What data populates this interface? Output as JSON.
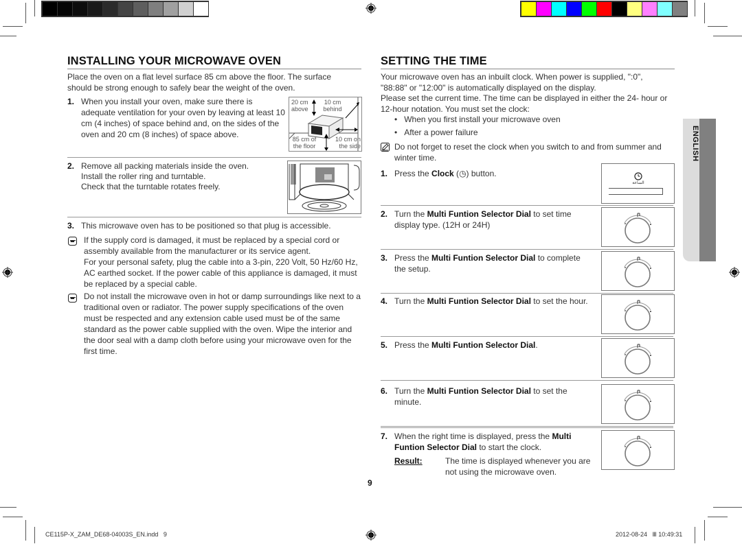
{
  "printer_marks": {
    "gray_swatches": [
      "#000000",
      "#050505",
      "#0d0d0d",
      "#1a1a1a",
      "#2b2b2b",
      "#444444",
      "#5e5e5e",
      "#7f7f7f",
      "#a0a0a0",
      "#d0d0d0",
      "#ffffff"
    ],
    "color_swatches": [
      "#ffff00",
      "#ff00ff",
      "#00ffff",
      "#0000ff",
      "#00ff00",
      "#ff0000",
      "#000000",
      "#ffff80",
      "#ff80ff",
      "#80ffff",
      "#808080"
    ]
  },
  "left": {
    "heading": "INSTALLING YOUR MICROWAVE OVEN",
    "intro": "Place the oven on a flat level surface 85 cm above the floor. The surface should be strong enough to safely bear the weight of the oven.",
    "step1": {
      "num": "1.",
      "text": "When you install your oven, make sure there is adequate ventilation for your oven by leaving at least 10 cm (4 inches) of space behind and, on the sides of the oven and 20 cm (8 inches) of space above.",
      "figure_labels": {
        "above": "20 cm above",
        "behind": "10 cm behind",
        "floor": "85 cm of the floor",
        "side": "10 cm on the side"
      }
    },
    "step2": {
      "num": "2.",
      "lines": [
        "Remove all packing materials inside the oven.",
        "Install the roller ring and turntable.",
        "Check that the turntable rotates freely."
      ]
    },
    "step3": {
      "num": "3.",
      "text": "This microwave oven has to be positioned so that plug is accessible."
    },
    "note1": {
      "line1": "If the supply cord is damaged, it must be replaced by a special cord or assembly available from the manufacturer or its service agent.",
      "line2": "For your personal safety, plug the cable into a 3-pin, 220 Volt, 50 Hz/60 Hz, AC earthed socket. If the power cable of this appliance is damaged, it must be replaced by a special cable."
    },
    "note2": {
      "text": "Do not install the microwave oven in hot or damp surroundings like next to a traditional oven or radiator. The power supply specifications of the oven must be respected and any extension cable used must be of the same standard as the power cable supplied with the oven. Wipe the interior and the door seal with a damp cloth before using your microwave oven for the first time."
    }
  },
  "right": {
    "heading": "SETTING THE TIME",
    "intro1": "Your microwave oven has an inbuilt clock. When power is supplied, \":0\", \"88:88\" or \"12:00\" is automatically displayed on the display.",
    "intro2": "Please set the current time. The time can be displayed in either the 24- hour or 12-hour notation. You must set the clock:",
    "bullets": [
      "When you first install your microwave oven",
      "After a power failure"
    ],
    "note": "Do not forget to reset the clock when you switch to and from summer and winter time.",
    "steps": [
      {
        "num": "1.",
        "pre": "Press the ",
        "bold": "Clock",
        "post": " button.",
        "clock_glyph": "◷"
      },
      {
        "num": "2.",
        "pre": "Turn the ",
        "bold": "Multi Funtion Selector Dial",
        "post": " to set time display type. (12H or 24H)"
      },
      {
        "num": "3.",
        "pre": "Press the ",
        "bold": "Multi Funtion Selector Dial",
        "post": " to complete the setup."
      },
      {
        "num": "4.",
        "pre": "Turn the ",
        "bold": "Multi Funtion Selector Dial",
        "post": " to set the hour."
      },
      {
        "num": "5.",
        "pre": "Press the ",
        "bold": "Multi Funtion Selector Dial",
        "post": "."
      },
      {
        "num": "6.",
        "pre": "Turn the ",
        "bold": "Multi Funtion Selector Dial",
        "post": " to set the minute."
      },
      {
        "num": "7.",
        "pre": "When the right time is displayed, press the ",
        "bold": "Multi Funtion Selector Dial",
        "post": " to start the clock."
      }
    ],
    "clock_panel_label": "الساعة",
    "result_label": "Result:",
    "result_text": "The time is displayed whenever you are not using the microwave oven.",
    "language_tab": "ENGLISH"
  },
  "page_number": "9",
  "footer": {
    "file": "CE115P-X_ZAM_DE68-04003S_EN.indd   9",
    "timestamp": "2012-08-24   Ⅲ 10:49:31"
  }
}
